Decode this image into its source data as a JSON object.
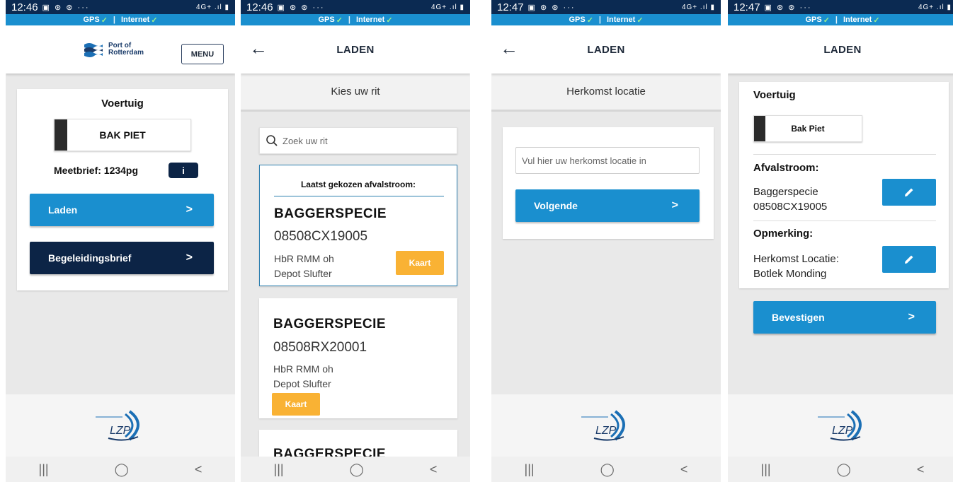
{
  "status": {
    "p1_time": "12:46",
    "p2_time": "12:46",
    "p3_time": "12:47",
    "p4_time": "12:47",
    "icons": "▣ ⊛ ⊛ ···",
    "signal": "4G+ .ıl ▮",
    "gps_label": "GPS",
    "internet_label": "Internet",
    "check": "✓",
    "sep": "|"
  },
  "screen1": {
    "logo_line1": "Port of",
    "logo_line2": "Rotterdam",
    "menu_label": "MENU",
    "vehicle_heading": "Voertuig",
    "vehicle_name": "BAK PIET",
    "meetbrief": "Meetbrief: 1234pg",
    "info_label": "i",
    "laden_label": "Laden",
    "begeleiding_label": "Begeleidingsbrief",
    "chevron": ">"
  },
  "screen2": {
    "title": "LADEN",
    "subheading": "Kies uw rit",
    "search_placeholder": "Zoek uw rit",
    "last_chosen_label": "Laatst gekozen afvalstroom:",
    "rides": [
      {
        "type": "BAGGERSPECIE",
        "code": "08508CX19005",
        "line1": "HbR RMM oh",
        "line2": "Depot Slufter",
        "button": "Kaart"
      },
      {
        "type": "BAGGERSPECIE",
        "code": "08508RX20001",
        "line1": "HbR RMM oh",
        "line2": "Depot Slufter",
        "button": "Kaart"
      },
      {
        "type": "BAGGERSPECIE"
      }
    ]
  },
  "screen3": {
    "title": "LADEN",
    "subheading": "Herkomst locatie",
    "input_placeholder": "Vul hier uw herkomst locatie in",
    "next_label": "Volgende",
    "chevron": ">"
  },
  "screen4": {
    "title": "LADEN",
    "vehicle_heading": "Voertuig",
    "vehicle_name": "Bak Piet",
    "afvalstroom_heading": "Afvalstroom:",
    "afvalstroom_line1": "Baggerspecie",
    "afvalstroom_line2": "08508CX19005",
    "opmerking_heading": "Opmerking:",
    "opmerking_line1": "Herkomst Locatie:",
    "opmerking_line2": "Botlek Monding",
    "confirm_label": "Bevestigen",
    "chevron": ">"
  },
  "nav": {
    "recent": "|||",
    "home": "◯",
    "back": "<"
  },
  "back_arrow": "←",
  "footer_logo_text": "LZP",
  "colors": {
    "primary": "#1a8fcf",
    "navy": "#0c2446",
    "orange": "#f9b234"
  }
}
